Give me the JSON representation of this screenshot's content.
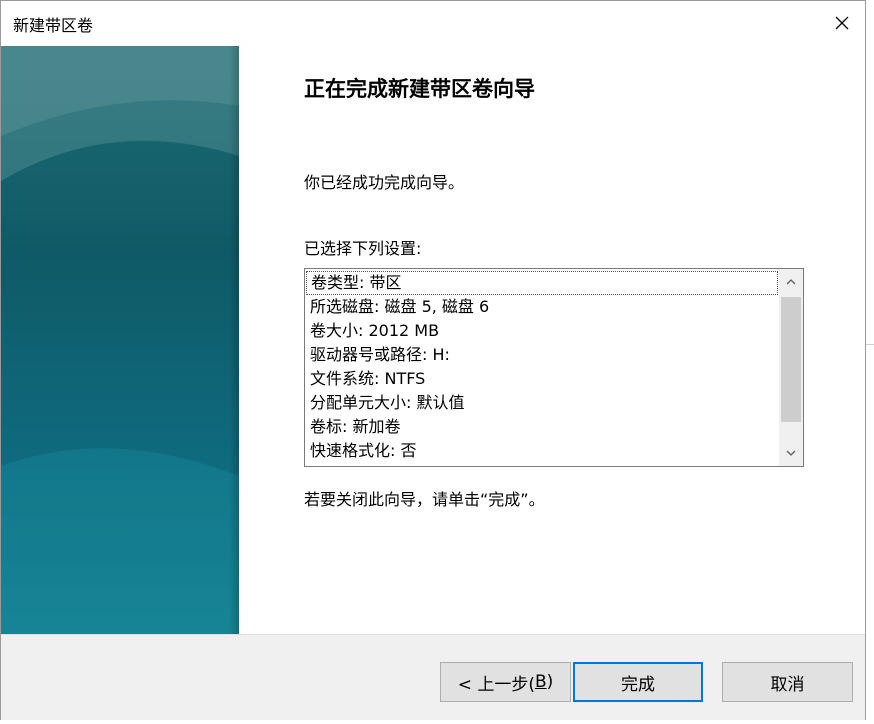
{
  "window": {
    "title": "新建带区卷"
  },
  "wizard": {
    "heading": "正在完成新建带区卷向导",
    "success_text": "你已经成功完成向导。",
    "settings_label": "已选择下列设置:",
    "settings": [
      "卷类型: 带区",
      "所选磁盘: 磁盘 5, 磁盘 6",
      "卷大小: 2012 MB",
      "驱动器号或路径: H:",
      "文件系统: NTFS",
      "分配单元大小: 默认值",
      "卷标: 新加卷",
      "快速格式化: 否"
    ],
    "close_hint": "若要关闭此向导，请单击“完成”。"
  },
  "buttons": {
    "back_prefix": "< 上一步(",
    "back_accel": "B",
    "back_suffix": ")",
    "finish": "完成",
    "cancel": "取消"
  },
  "colors": {
    "accent": "#0078d7",
    "banner_dark": "#0f5a66",
    "banner_light": "#158090"
  },
  "icons": {
    "close": "close-icon",
    "scroll_up": "chevron-up-icon",
    "scroll_down": "chevron-down-icon"
  }
}
